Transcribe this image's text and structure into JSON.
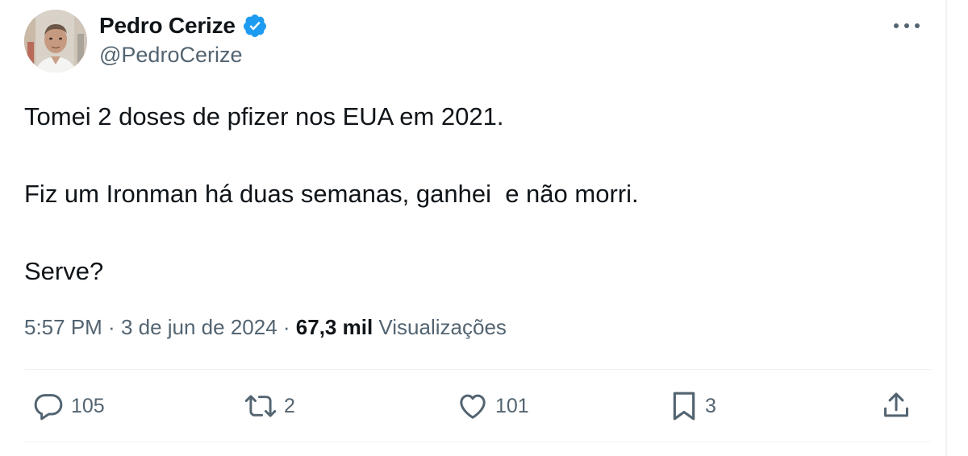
{
  "author": {
    "name": "Pedro Cerize",
    "handle": "@PedroCerize",
    "verified_icon": "verified-badge-icon"
  },
  "tweet": {
    "text": "Tomei 2 doses de pfizer nos EUA em 2021.\n\nFiz um Ironman há duas semanas, ganhei  e não morri.\n\nServe?"
  },
  "meta": {
    "time": "5:57 PM",
    "separator": " · ",
    "date": "3 de jun de 2024",
    "separator2": " · ",
    "views_count": "67,3 mil",
    "views_label": " Visualizações"
  },
  "actions": {
    "replies": "105",
    "reposts": "2",
    "likes": "101",
    "bookmarks": "3"
  },
  "icons": [
    "more-icon",
    "reply-icon",
    "repost-icon",
    "like-icon",
    "bookmark-icon",
    "share-icon"
  ],
  "colors": {
    "verified": "#1d9bf0",
    "text": "#0f1419",
    "secondary": "#536471",
    "divider": "#eff3f4"
  }
}
